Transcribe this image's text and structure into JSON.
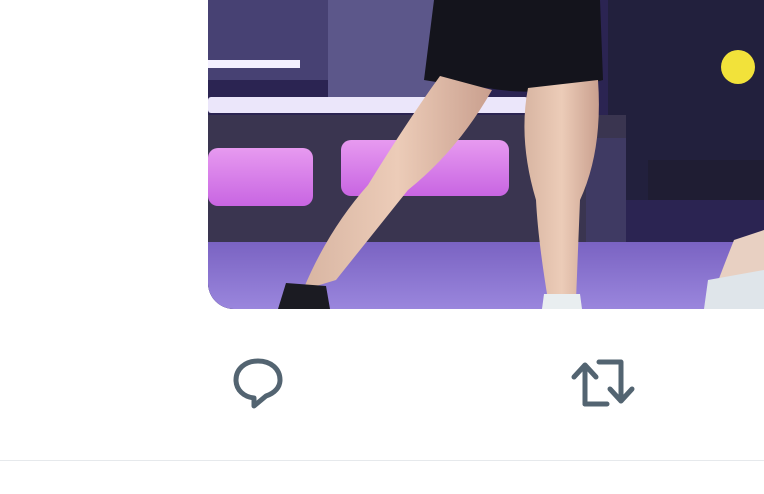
{
  "tweet": {
    "media": {
      "icon": "photo-concert-dancer-legs"
    },
    "actions": [
      {
        "name": "reply",
        "icon": "speech-bubble-icon",
        "count": ""
      },
      {
        "name": "retweet",
        "icon": "retweet-arrows-icon",
        "count": ""
      }
    ]
  },
  "colors": {
    "icon": "#536471",
    "divider": "#e6e9ec",
    "background": "#ffffff"
  }
}
